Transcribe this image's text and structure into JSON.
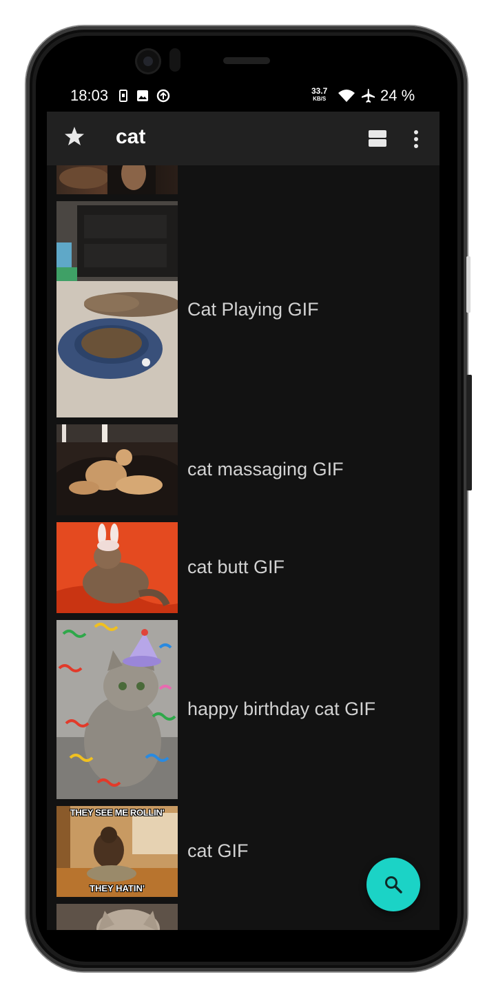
{
  "status_bar": {
    "time": "18:03",
    "net_speed": "33.7",
    "net_unit": "KB/S",
    "battery": "24 %",
    "icons": [
      "sim-icon",
      "image-icon",
      "data-saver-icon",
      "wifi-icon",
      "airplane-icon"
    ]
  },
  "toolbar": {
    "title": "cat",
    "icons": [
      "star-icon",
      "view-toggle-icon",
      "more-icon"
    ]
  },
  "items": [
    {
      "label": ""
    },
    {
      "label": "Cat Playing GIF"
    },
    {
      "label": "cat massaging GIF"
    },
    {
      "label": "cat butt GIF"
    },
    {
      "label": "happy birthday cat GIF"
    },
    {
      "label": "cat GIF"
    },
    {
      "label": ""
    }
  ],
  "thumb_text": {
    "cat_gif_top": "THEY SEE ME ROLLIN'",
    "cat_gif_bottom": "THEY HATIN'"
  },
  "fab": {
    "icon": "search-icon"
  },
  "colors": {
    "accent": "#1bd3c6",
    "background": "#121212",
    "toolbar": "#212121",
    "text": "#d2d2d2"
  }
}
